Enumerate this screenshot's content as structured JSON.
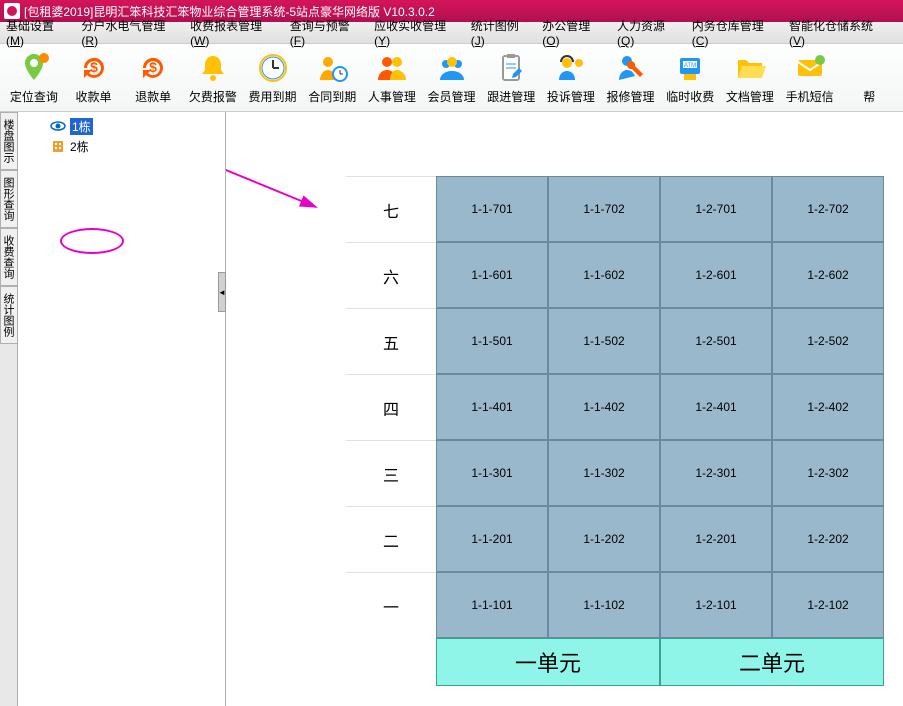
{
  "titlebar": {
    "text": "[包租婆2019]昆明汇笨科技汇笨物业综合管理系统-5站点豪华网络版 V10.3.0.2"
  },
  "menubar": [
    {
      "label": "基础设置",
      "key": "M"
    },
    {
      "label": "分户水电气管理",
      "key": "R"
    },
    {
      "label": "收费报表管理",
      "key": "W"
    },
    {
      "label": "查询与预警",
      "key": "F"
    },
    {
      "label": "应收实收管理",
      "key": "Y"
    },
    {
      "label": "统计图例",
      "key": "J"
    },
    {
      "label": "办公管理",
      "key": "O"
    },
    {
      "label": "人力资源",
      "key": "Q"
    },
    {
      "label": "内务仓库管理",
      "key": "C"
    },
    {
      "label": "智能化仓储系统",
      "key": "V"
    }
  ],
  "toolbar": [
    {
      "name": "定位查询",
      "icon": "pin",
      "colors": [
        "#ff8c00",
        "#7ac943"
      ]
    },
    {
      "name": "收款单",
      "icon": "dollar-cycle",
      "colors": [
        "#ff5a00"
      ]
    },
    {
      "name": "退款单",
      "icon": "dollar-cycle",
      "colors": [
        "#ff5a00"
      ]
    },
    {
      "name": "欠费报警",
      "icon": "bell",
      "colors": [
        "#ffc107"
      ]
    },
    {
      "name": "费用到期",
      "icon": "clock",
      "colors": [
        "#ffc107",
        "#2196f3"
      ]
    },
    {
      "name": "合同到期",
      "icon": "person-clock",
      "colors": [
        "#ffaa00",
        "#2196f3"
      ]
    },
    {
      "name": "人事管理",
      "icon": "people",
      "colors": [
        "#ff5a00",
        "#ffc107"
      ]
    },
    {
      "name": "会员管理",
      "icon": "members",
      "colors": [
        "#2196f3",
        "#ffc107"
      ]
    },
    {
      "name": "跟进管理",
      "icon": "clipboard",
      "colors": [
        "#999",
        "#2196f3"
      ]
    },
    {
      "name": "投诉管理",
      "icon": "support",
      "colors": [
        "#2196f3",
        "#ffc107"
      ]
    },
    {
      "name": "报修管理",
      "icon": "wrench-person",
      "colors": [
        "#2196f3",
        "#ff5a00"
      ]
    },
    {
      "name": "临时收费",
      "icon": "atm",
      "colors": [
        "#2196f3",
        "#ffc107"
      ]
    },
    {
      "name": "文档管理",
      "icon": "folder",
      "colors": [
        "#ffc107"
      ]
    },
    {
      "name": "手机短信",
      "icon": "mail",
      "colors": [
        "#ffc107",
        "#7ac943"
      ]
    },
    {
      "name": "帮",
      "icon": "",
      "colors": []
    }
  ],
  "side_tabs": [
    "楼盘图示",
    "图形查询",
    "收费查询",
    "统计图例"
  ],
  "tree": [
    {
      "label": "1栋",
      "selected": true,
      "icon": "eye"
    },
    {
      "label": "2栋",
      "selected": false,
      "icon": "building"
    }
  ],
  "collapse_char": "◄",
  "floors": [
    "七",
    "六",
    "五",
    "四",
    "三",
    "二",
    "一"
  ],
  "rooms": [
    [
      "1-1-701",
      "1-1-702",
      "1-2-701",
      "1-2-702"
    ],
    [
      "1-1-601",
      "1-1-602",
      "1-2-601",
      "1-2-602"
    ],
    [
      "1-1-501",
      "1-1-502",
      "1-2-501",
      "1-2-502"
    ],
    [
      "1-1-401",
      "1-1-402",
      "1-2-401",
      "1-2-402"
    ],
    [
      "1-1-301",
      "1-1-302",
      "1-2-301",
      "1-2-302"
    ],
    [
      "1-1-201",
      "1-1-202",
      "1-2-201",
      "1-2-202"
    ],
    [
      "1-1-101",
      "1-1-102",
      "1-2-101",
      "1-2-102"
    ]
  ],
  "units": [
    "一单元",
    "二单元"
  ]
}
